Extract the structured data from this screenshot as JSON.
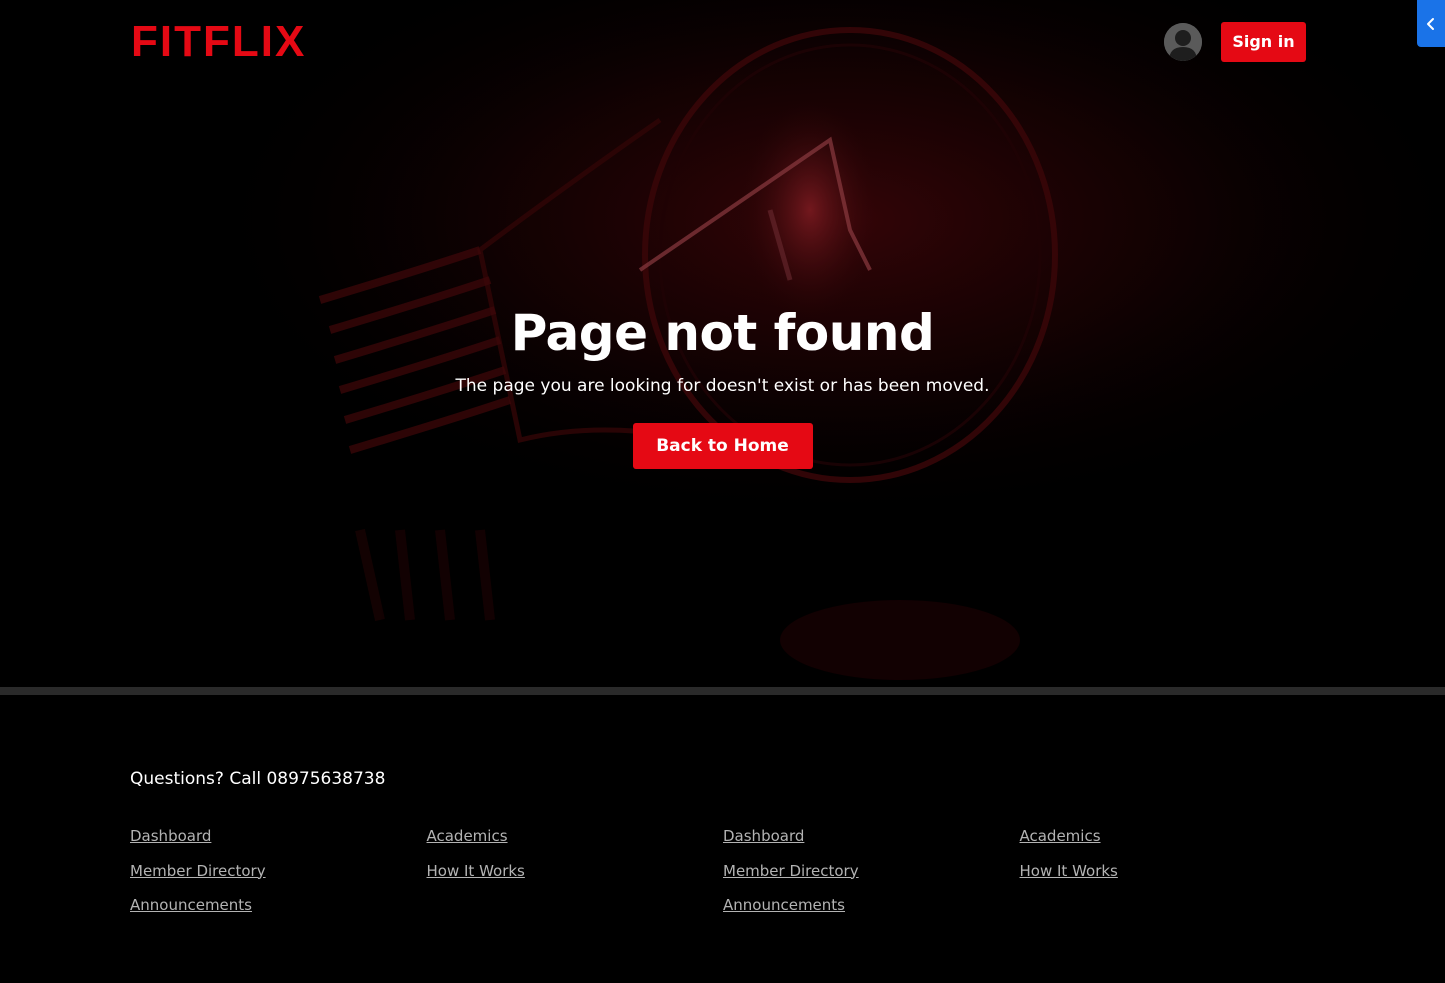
{
  "header": {
    "logo": "FITFLIX",
    "signin_label": "Sign in"
  },
  "icons": {
    "avatar": "user-avatar-icon",
    "side_toggle": "chevron-left-icon"
  },
  "main": {
    "title": "Page not found",
    "subtitle": "The page you are looking for doesn't exist or has been moved.",
    "home_button_label": "Back to Home"
  },
  "footer": {
    "contact": "Questions? Call 08975638738",
    "columns": [
      {
        "links": [
          "Dashboard",
          "Member Directory",
          "Announcements"
        ]
      },
      {
        "links": [
          "Academics",
          "How It Works"
        ]
      },
      {
        "links": [
          "Dashboard",
          "Member Directory",
          "Announcements"
        ]
      },
      {
        "links": [
          "Academics",
          "How It Works"
        ]
      }
    ]
  },
  "colors": {
    "brand_red": "#e50914",
    "background": "#000000",
    "toggle_blue": "#1a73e8",
    "link_gray": "#b3b3b3"
  }
}
